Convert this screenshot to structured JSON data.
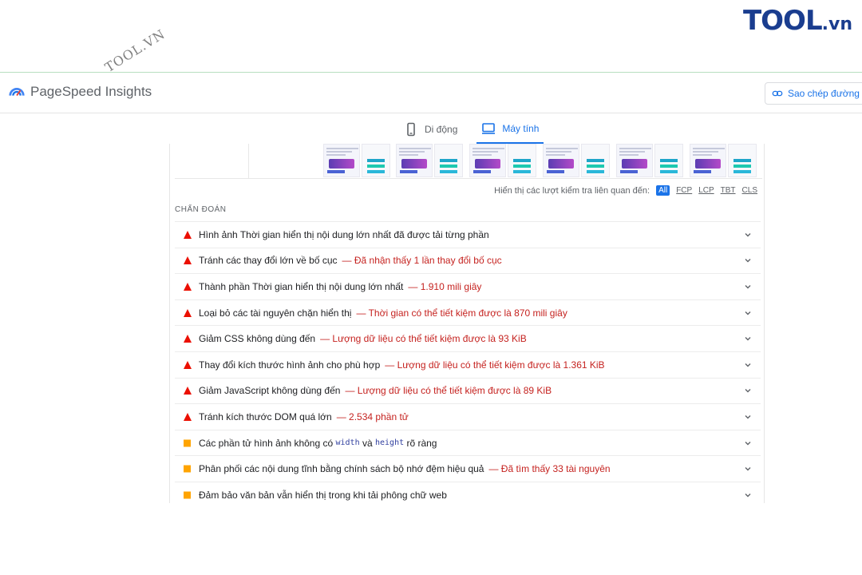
{
  "brand": {
    "name": "TOOL",
    "domain": ".vn",
    "color": "#1a3d8f"
  },
  "watermark": "TOOL.VN",
  "header": {
    "logo_text": "PageSpeed Insights",
    "copy_button_label": "Sao chép đường liên kết"
  },
  "tabs": [
    {
      "label": "Di động",
      "icon": "mobile-icon",
      "active": false
    },
    {
      "label": "Máy tính",
      "icon": "desktop-icon",
      "active": true
    }
  ],
  "filter": {
    "label": "Hiển thị các lượt kiểm tra liên quan đến:",
    "chips": [
      "All",
      "FCP",
      "LCP",
      "TBT",
      "CLS"
    ],
    "active_chip": "All"
  },
  "section_title": "CHẨN ĐOÁN",
  "diagnostics": [
    {
      "severity": "fail",
      "title": "Hình ảnh Thời gian hiển thị nội dung lớn nhất đã được tải từng phần",
      "display": ""
    },
    {
      "severity": "fail",
      "title": "Tránh các thay đổi lớn về bố cục",
      "display": "— Đã nhận thấy 1 lần thay đổi bố cục"
    },
    {
      "severity": "fail",
      "title": "Thành phần Thời gian hiển thị nội dung lớn nhất",
      "display": "— 1.910 mili giây"
    },
    {
      "severity": "fail",
      "title": "Loại bỏ các tài nguyên chặn hiển thị",
      "display": "— Thời gian có thể tiết kiệm được là 870 mili giây"
    },
    {
      "severity": "fail",
      "title": "Giảm CSS không dùng đến",
      "display": "— Lượng dữ liệu có thể tiết kiệm được là 93 KiB"
    },
    {
      "severity": "fail",
      "title": "Thay đổi kích thước hình ảnh cho phù hợp",
      "display": "— Lượng dữ liệu có thể tiết kiệm được là 1.361 KiB"
    },
    {
      "severity": "fail",
      "title": "Giảm JavaScript không dùng đến",
      "display": "— Lượng dữ liệu có thể tiết kiệm được là 89 KiB"
    },
    {
      "severity": "fail",
      "title": "Tránh kích thước DOM quá lớn",
      "display": "— 2.534 phần tử"
    },
    {
      "severity": "average",
      "title_prefix": "Các phần tử hình ảnh không có",
      "code1": "width",
      "and_text": "và",
      "code2": "height",
      "title_suffix": "rõ ràng"
    },
    {
      "severity": "average",
      "title": "Phân phối các nội dung tĩnh bằng chính sách bộ nhớ đệm hiệu quả",
      "display": "— Đã tìm thấy 33 tài nguyên"
    },
    {
      "severity": "average",
      "title": "Đảm bảo văn bản vẫn hiển thị trong khi tải phông chữ web",
      "display": ""
    }
  ],
  "colors": {
    "fail": "#eb0f00",
    "average": "#ffa400",
    "accent": "#1a73e8",
    "display": "#c5221f"
  }
}
